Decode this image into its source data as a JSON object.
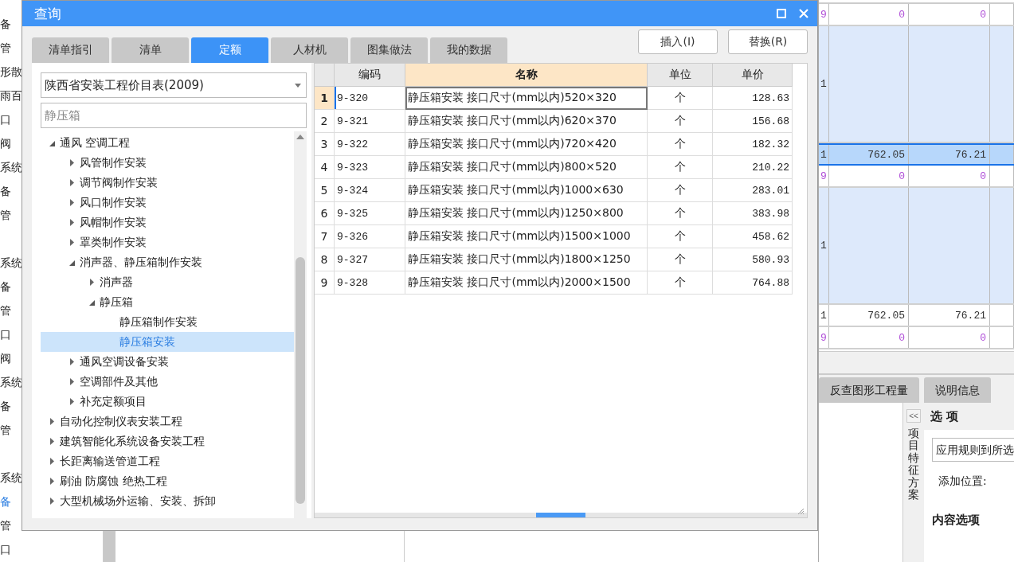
{
  "background_app": {
    "left_label_groups": [
      [
        {
          "label": "备",
          "selected": false
        },
        {
          "label": "管",
          "selected": false
        },
        {
          "label": "形散",
          "selected": false
        },
        {
          "label": "雨百",
          "selected": false
        },
        {
          "label": "口",
          "selected": false
        },
        {
          "label": "阀",
          "selected": false
        },
        {
          "label": "系统",
          "selected": false
        },
        {
          "label": "备",
          "selected": false
        },
        {
          "label": "管",
          "selected": false
        }
      ],
      [
        {
          "label": "系统",
          "selected": false
        },
        {
          "label": "备",
          "selected": false
        },
        {
          "label": "管",
          "selected": false
        },
        {
          "label": "口",
          "selected": false
        },
        {
          "label": "阀",
          "selected": false
        },
        {
          "label": "系统",
          "selected": false
        },
        {
          "label": "备",
          "selected": false
        },
        {
          "label": "管",
          "selected": false
        }
      ],
      [
        {
          "label": "系统",
          "selected": false
        },
        {
          "label": "备",
          "selected": true
        },
        {
          "label": "管",
          "selected": false
        },
        {
          "label": "口",
          "selected": false
        }
      ]
    ],
    "grid_rows": [
      {
        "kind": "zero",
        "cells": [
          "9",
          "0",
          "0"
        ],
        "selected": false
      },
      {
        "kind": "tall",
        "cells": [
          "1"
        ],
        "selected": false
      },
      {
        "kind": "total",
        "cells": [
          "1",
          "762.05",
          "76.21"
        ],
        "selected": true
      },
      {
        "kind": "zero",
        "cells": [
          "9",
          "0",
          "0"
        ],
        "selected": false
      },
      {
        "kind": "tall",
        "cells": [
          "1"
        ],
        "selected": false
      },
      {
        "kind": "total",
        "cells": [
          "1",
          "762.05",
          "76.21"
        ],
        "selected": false
      },
      {
        "kind": "zero",
        "cells": [
          "9",
          "0",
          "0"
        ],
        "selected": false
      }
    ],
    "bottom_tabs": [
      {
        "label": "反查图形工程量"
      },
      {
        "label": "说明信息"
      }
    ],
    "side_strip": {
      "collapse_button": "<<",
      "label": "项目特征方案"
    },
    "options_panel": {
      "title": "选 项",
      "dropdown_value": "应用规则到所选",
      "add_position_label": "添加位置:",
      "content_section_title": "内容选项"
    }
  },
  "dialog": {
    "title": "查询",
    "tabs": [
      {
        "label": "清单指引",
        "selected": false
      },
      {
        "label": "清单",
        "selected": false
      },
      {
        "label": "定额",
        "selected": true
      },
      {
        "label": "人材机",
        "selected": false
      },
      {
        "label": "图集做法",
        "selected": false
      },
      {
        "label": "我的数据",
        "selected": false
      }
    ],
    "library_select": {
      "value": "陕西省安装工程价目表(2009)"
    },
    "search": {
      "value": "静压箱"
    },
    "tree": [
      {
        "label": "通风 空调工程",
        "expanded": true,
        "selected": false,
        "children": [
          {
            "label": "风管制作安装",
            "expanded": false,
            "selected": false
          },
          {
            "label": "调节阀制作安装",
            "expanded": false,
            "selected": false
          },
          {
            "label": "风口制作安装",
            "expanded": false,
            "selected": false
          },
          {
            "label": "风帽制作安装",
            "expanded": false,
            "selected": false
          },
          {
            "label": "罩类制作安装",
            "expanded": false,
            "selected": false
          },
          {
            "label": "消声器、静压箱制作安装",
            "expanded": true,
            "selected": false,
            "children": [
              {
                "label": "消声器",
                "expanded": false,
                "selected": false
              },
              {
                "label": "静压箱",
                "expanded": true,
                "selected": false,
                "children": [
                  {
                    "label": "静压箱制作安装",
                    "selected": false
                  },
                  {
                    "label": "静压箱安装",
                    "selected": true
                  }
                ]
              }
            ]
          },
          {
            "label": "通风空调设备安装",
            "expanded": false,
            "selected": false
          },
          {
            "label": "空调部件及其他",
            "expanded": false,
            "selected": false
          },
          {
            "label": "补充定额项目",
            "expanded": false,
            "selected": false
          }
        ]
      },
      {
        "label": "自动化控制仪表安装工程",
        "expanded": false,
        "selected": false
      },
      {
        "label": "建筑智能化系统设备安装工程",
        "expanded": false,
        "selected": false
      },
      {
        "label": "长距离输送管道工程",
        "expanded": false,
        "selected": false
      },
      {
        "label": "刷油 防腐蚀 绝热工程",
        "expanded": false,
        "selected": false
      },
      {
        "label": "大型机械场外运输、安装、拆卸",
        "expanded": false,
        "selected": false
      }
    ],
    "buttons": [
      "插入(I)",
      "替换(R)"
    ],
    "table": {
      "columns": [
        "编码",
        "名称",
        "单位",
        "单价"
      ],
      "rows": [
        {
          "index": "1",
          "code": "9-320",
          "name": "静压箱安装 接口尺寸(mm以内)520×320",
          "unit": "个",
          "price": "128.63",
          "selected": true
        },
        {
          "index": "2",
          "code": "9-321",
          "name": "静压箱安装 接口尺寸(mm以内)620×370",
          "unit": "个",
          "price": "156.68",
          "selected": false
        },
        {
          "index": "3",
          "code": "9-322",
          "name": "静压箱安装 接口尺寸(mm以内)720×420",
          "unit": "个",
          "price": "182.32",
          "selected": false
        },
        {
          "index": "4",
          "code": "9-323",
          "name": "静压箱安装 接口尺寸(mm以内)800×520",
          "unit": "个",
          "price": "210.22",
          "selected": false
        },
        {
          "index": "5",
          "code": "9-324",
          "name": "静压箱安装 接口尺寸(mm以内)1000×630",
          "unit": "个",
          "price": "283.01",
          "selected": false
        },
        {
          "index": "6",
          "code": "9-325",
          "name": "静压箱安装 接口尺寸(mm以内)1250×800",
          "unit": "个",
          "price": "383.98",
          "selected": false
        },
        {
          "index": "7",
          "code": "9-326",
          "name": "静压箱安装 接口尺寸(mm以内)1500×1000",
          "unit": "个",
          "price": "458.62",
          "selected": false
        },
        {
          "index": "8",
          "code": "9-327",
          "name": "静压箱安装 接口尺寸(mm以内)1800×1250",
          "unit": "个",
          "price": "580.93",
          "selected": false
        },
        {
          "index": "9",
          "code": "9-328",
          "name": "静压箱安装 接口尺寸(mm以内)2000×1500",
          "unit": "个",
          "price": "764.88",
          "selected": false
        }
      ]
    }
  }
}
